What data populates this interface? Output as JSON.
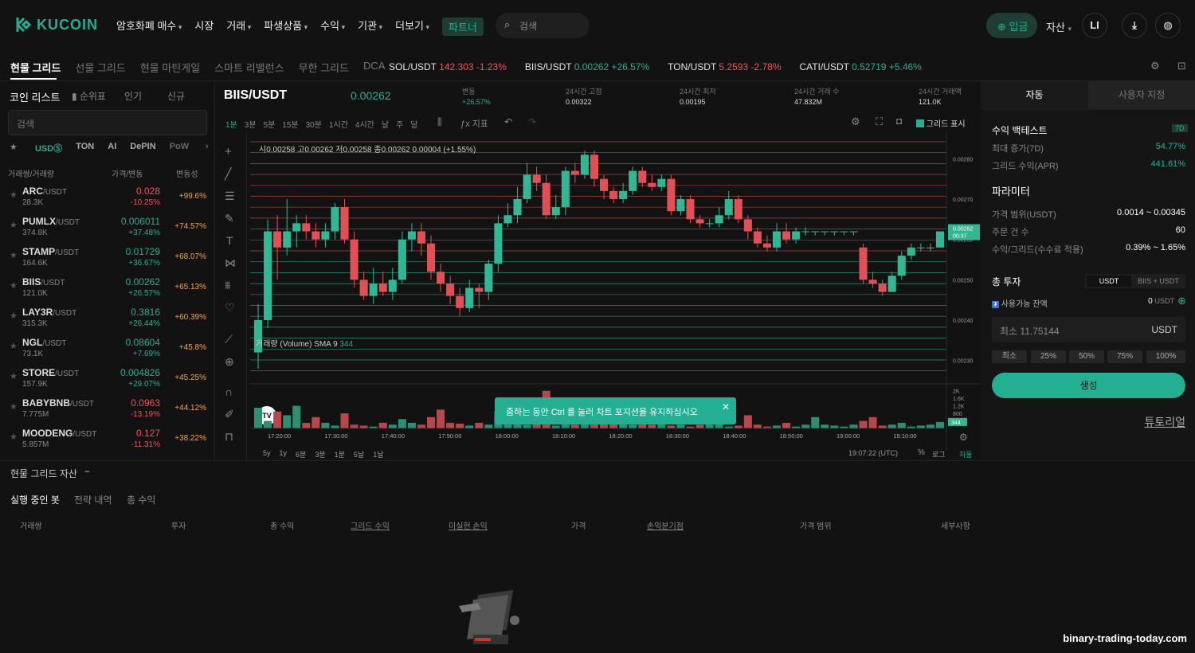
{
  "nav": {
    "logo": "KUCOIN",
    "items": [
      "암호화폐 매수",
      "시장",
      "거래",
      "파생상품",
      "수익",
      "기관",
      "더보기"
    ],
    "partner": "파트너",
    "search_placeholder": "검색",
    "deposit": "입금",
    "assets": "자산",
    "avatar": "LI"
  },
  "subtabs": [
    "현물 그리드",
    "선물 그리드",
    "현물 마틴게일",
    "스마트 리밸런스",
    "무한 그리드",
    "DCA"
  ],
  "tickers": [
    {
      "pair": "SOL/USDT",
      "price": "142.303",
      "change": "-1.23%",
      "dir": "down"
    },
    {
      "pair": "BIIS/USDT",
      "price": "0.00262",
      "change": "+26.57%",
      "dir": "up"
    },
    {
      "pair": "TON/USDT",
      "price": "5.2593",
      "change": "-2.78%",
      "dir": "down"
    },
    {
      "pair": "CATI/USDT",
      "price": "0.52719",
      "change": "+5.46%",
      "dir": "up"
    }
  ],
  "coinlist": {
    "title": "코인 리스트",
    "tabs": [
      "순위표",
      "인기",
      "신규"
    ],
    "search": "검색",
    "filters": [
      "USDⓈ",
      "TON",
      "AI",
      "DePIN",
      "PoW"
    ],
    "headers": [
      "거래쌍/거래량",
      "가격/변동",
      "변동성"
    ],
    "rows": [
      {
        "base": "ARC",
        "quote": "/USDT",
        "vol": "28.3K",
        "price": "0.028",
        "change": "-10.25%",
        "dir": "down",
        "volatility": "+99.6%"
      },
      {
        "base": "PUMLX",
        "quote": "/USDT",
        "vol": "374.8K",
        "price": "0.006011",
        "change": "+37.48%",
        "dir": "up",
        "volatility": "+74.57%"
      },
      {
        "base": "STAMP",
        "quote": "/USDT",
        "vol": "164.6K",
        "price": "0.01729",
        "change": "+36.67%",
        "dir": "up",
        "volatility": "+68.07%"
      },
      {
        "base": "BIIS",
        "quote": "/USDT",
        "vol": "121.0K",
        "price": "0.00262",
        "change": "+26.57%",
        "dir": "up",
        "volatility": "+65.13%"
      },
      {
        "base": "LAY3R",
        "quote": "/USDT",
        "vol": "315.3K",
        "price": "0.3816",
        "change": "+26.44%",
        "dir": "up",
        "volatility": "+60.39%"
      },
      {
        "base": "NGL",
        "quote": "/USDT",
        "vol": "73.1K",
        "price": "0.08604",
        "change": "+7.69%",
        "dir": "up",
        "volatility": "+45.8%"
      },
      {
        "base": "STORE",
        "quote": "/USDT",
        "vol": "157.9K",
        "price": "0.004826",
        "change": "+29.07%",
        "dir": "up",
        "volatility": "+45.25%"
      },
      {
        "base": "BABYBNB",
        "quote": "/USDT",
        "vol": "7.775M",
        "price": "0.0963",
        "change": "-13.19%",
        "dir": "down",
        "volatility": "+44.12%"
      },
      {
        "base": "MOODENG",
        "quote": "/USDT",
        "vol": "5.857M",
        "price": "0.127",
        "change": "-11.31%",
        "dir": "down",
        "volatility": "+38.22%"
      }
    ]
  },
  "pairheader": {
    "pair": "BIIS/USDT",
    "price": "0.00262",
    "stats": [
      {
        "label": "변동",
        "value": "+26.57%"
      },
      {
        "label": "24시간 고점",
        "value": "0.00322"
      },
      {
        "label": "24시간 최저",
        "value": "0.00195"
      },
      {
        "label": "24시간 거래 수",
        "value": "47.832M"
      },
      {
        "label": "24시간 거래액",
        "value": "121.0K"
      }
    ]
  },
  "toolbar": {
    "intervals": [
      "1분",
      "3분",
      "5분",
      "15분",
      "30분",
      "1시간",
      "4시간",
      "날",
      "주",
      "달"
    ],
    "indicator": "지표",
    "gridshow": "그리드 표시"
  },
  "chart": {
    "ohlc": "시0.00258 고0.00262 저0.00258 종0.00262 0.00004 (+1.55%)",
    "price_axis": [
      "0.00280",
      "0.00270",
      "0.00260",
      "0.00250",
      "0.00240",
      "0.00230"
    ],
    "current_tag": "0.00262",
    "countdown": "00:37",
    "volume_label": "거래량 (Volume) SMA 9",
    "volume_value": "344",
    "vol_axis": [
      "2K",
      "1.6K",
      "1.2K",
      "800",
      "400"
    ],
    "vol_tag": "344",
    "times": [
      "17:20:00",
      "17:30:00",
      "17:40:00",
      "17:50:00",
      "18:00:00",
      "18:10:00",
      "18:20:00",
      "18:30:00",
      "18:40:00",
      "18:50:00",
      "19:00:00",
      "19:10:00"
    ],
    "ranges": [
      "5y",
      "1y",
      "6분",
      "3분",
      "1분",
      "5날",
      "1날"
    ],
    "clock": "19:07:22 (UTC)",
    "pct": "%",
    "log": "로그",
    "auto": "자동",
    "toast": "줌하는 동안 Ctrl 를 눌러 차트 포지션을 유지하십시오"
  },
  "chart_data": {
    "type": "candlestick",
    "ylim": [
      0.00225,
      0.00285
    ],
    "candles": [
      [
        0.00232,
        0.0024,
        0.00244,
        0.00228
      ],
      [
        0.0024,
        0.00262,
        0.00265,
        0.00238
      ],
      [
        0.00262,
        0.00258,
        0.00266,
        0.0025
      ],
      [
        0.00258,
        0.00262,
        0.0027,
        0.00256
      ],
      [
        0.00262,
        0.00264,
        0.00266,
        0.00258
      ],
      [
        0.00264,
        0.00262,
        0.00266,
        0.0026
      ],
      [
        0.00262,
        0.0026,
        0.00264,
        0.00258
      ],
      [
        0.0026,
        0.00262,
        0.00264,
        0.00258
      ],
      [
        0.00262,
        0.00268,
        0.00269,
        0.0026
      ],
      [
        0.00268,
        0.0026,
        0.0027,
        0.00259
      ],
      [
        0.0026,
        0.0025,
        0.00262,
        0.00248
      ],
      [
        0.0025,
        0.00246,
        0.00252,
        0.00245
      ],
      [
        0.00246,
        0.00249,
        0.00253,
        0.00244
      ],
      [
        0.00249,
        0.00247,
        0.00252,
        0.00246
      ],
      [
        0.00247,
        0.0025,
        0.00253,
        0.00245
      ],
      [
        0.0025,
        0.0026,
        0.00262,
        0.00249
      ],
      [
        0.0026,
        0.00262,
        0.00264,
        0.00257
      ],
      [
        0.00262,
        0.00259,
        0.00264,
        0.00256
      ],
      [
        0.00259,
        0.00252,
        0.00261,
        0.0025
      ],
      [
        0.00252,
        0.00249,
        0.00254,
        0.00247
      ],
      [
        0.00249,
        0.00246,
        0.00251,
        0.00244
      ],
      [
        0.00246,
        0.00243,
        0.00248,
        0.00241
      ],
      [
        0.00243,
        0.00248,
        0.0025,
        0.00242
      ],
      [
        0.00248,
        0.00247,
        0.00249,
        0.00243
      ],
      [
        0.00247,
        0.00254,
        0.00255,
        0.00245
      ],
      [
        0.00254,
        0.00264,
        0.00266,
        0.00252
      ],
      [
        0.00264,
        0.00266,
        0.00269,
        0.00263
      ],
      [
        0.00266,
        0.0027,
        0.00273,
        0.00264
      ],
      [
        0.0027,
        0.00276,
        0.00279,
        0.00269
      ],
      [
        0.00276,
        0.00274,
        0.00278,
        0.00272
      ],
      [
        0.00274,
        0.00266,
        0.00276,
        0.00265
      ],
      [
        0.00266,
        0.00268,
        0.00271,
        0.00265
      ],
      [
        0.00268,
        0.00277,
        0.00278,
        0.00266
      ],
      [
        0.00277,
        0.00276,
        0.00279,
        0.00274
      ],
      [
        0.00276,
        0.00281,
        0.00282,
        0.00275
      ],
      [
        0.00281,
        0.00275,
        0.00282,
        0.00273
      ],
      [
        0.00275,
        0.00272,
        0.00276,
        0.0027
      ],
      [
        0.00272,
        0.0027,
        0.00273,
        0.00269
      ],
      [
        0.0027,
        0.00272,
        0.00274,
        0.00269
      ],
      [
        0.00272,
        0.00277,
        0.00278,
        0.00271
      ],
      [
        0.00277,
        0.00274,
        0.00278,
        0.00273
      ],
      [
        0.00274,
        0.00273,
        0.00276,
        0.00272
      ],
      [
        0.00273,
        0.00275,
        0.00276,
        0.00272
      ],
      [
        0.00275,
        0.00267,
        0.00276,
        0.00266
      ],
      [
        0.00267,
        0.0027,
        0.00271,
        0.00266
      ],
      [
        0.0027,
        0.00265,
        0.00271,
        0.00264
      ],
      [
        0.00265,
        0.00264,
        0.00266,
        0.00263
      ],
      [
        0.00264,
        0.00264,
        0.00265,
        0.00263
      ],
      [
        0.00264,
        0.00266,
        0.00268,
        0.00263
      ],
      [
        0.00266,
        0.0027,
        0.00272,
        0.00265
      ],
      [
        0.0027,
        0.00265,
        0.00271,
        0.00264
      ],
      [
        0.00265,
        0.00262,
        0.00266,
        0.0026
      ],
      [
        0.00262,
        0.00259,
        0.00263,
        0.00258
      ],
      [
        0.00259,
        0.00258,
        0.00261,
        0.00257
      ],
      [
        0.00258,
        0.00262,
        0.00264,
        0.00257
      ],
      [
        0.00262,
        0.0026,
        0.00264,
        0.00259
      ],
      [
        0.0026,
        0.00262,
        0.00263,
        0.00259
      ],
      [
        0.00262,
        0.00262,
        0.00263,
        0.00261
      ],
      [
        0.00262,
        0.00262,
        0.00262,
        0.00261
      ],
      [
        0.00262,
        0.00262,
        0.00262,
        0.00261
      ],
      [
        0.00262,
        0.00262,
        0.00262,
        0.00261
      ],
      [
        0.00262,
        0.00262,
        0.00262,
        0.00261
      ],
      [
        0.00262,
        0.00262,
        0.00262,
        0.00261
      ],
      [
        0.00258,
        0.0025,
        0.00259,
        0.00249
      ],
      [
        0.0025,
        0.00249,
        0.00252,
        0.00248
      ],
      [
        0.00249,
        0.00247,
        0.0025,
        0.00246
      ],
      [
        0.00247,
        0.00251,
        0.00252,
        0.00247
      ],
      [
        0.00251,
        0.00256,
        0.00257,
        0.0025
      ],
      [
        0.00256,
        0.00258,
        0.00259,
        0.00255
      ],
      [
        0.00258,
        0.00258,
        0.00259,
        0.00257
      ],
      [
        0.00258,
        0.00258,
        0.00259,
        0.00257
      ],
      [
        0.00258,
        0.00262,
        0.00262,
        0.00258
      ]
    ],
    "volumes": [
      1100,
      400,
      900,
      700,
      1200,
      300,
      600,
      300,
      150,
      800,
      200,
      150,
      100,
      300,
      200,
      500,
      300,
      200,
      600,
      1000,
      300,
      250,
      150,
      300,
      200,
      900,
      300,
      400,
      200,
      800,
      2000,
      150,
      600,
      200,
      300,
      1000,
      500,
      400,
      300,
      200,
      900,
      200,
      300,
      150,
      200,
      100,
      200,
      300,
      400,
      100,
      150,
      700,
      200,
      100,
      150,
      300,
      100,
      200,
      600,
      200,
      150,
      100,
      200,
      400,
      600,
      150,
      200,
      300,
      100,
      150,
      200,
      344
    ]
  },
  "rightpanel": {
    "tabs": [
      "자동",
      "사용자 지정"
    ],
    "backtest": "수익 백테스트",
    "period": "7D",
    "max_inc_label": "최대 증가(7D)",
    "max_inc": "54.77%",
    "apr_label": "그리드 수익(APR)",
    "apr": "441.61%",
    "params": "파라미터",
    "range_label": "가격 범위(USDT)",
    "range": "0.0014 ~ 0.00345",
    "orders_label": "주문 건 수",
    "orders": "60",
    "profit_label": "수익/그리드(수수료 적용)",
    "profit": "0.39% ~ 1.65%",
    "invest": "총 투자",
    "ccy1": "USDT",
    "ccy2": "BIIS + USDT",
    "avail": "사용가능 잔액",
    "avail_val": "0",
    "avail_ccy": "USDT",
    "min_placeholder": "최소 11.75144",
    "input_ccy": "USDT",
    "pcts": [
      "최소",
      "25%",
      "50%",
      "75%",
      "100%"
    ],
    "create": "생성",
    "tutorial": "튜토리얼"
  },
  "bottom": {
    "title": "현물 그리드 자산",
    "tabs": [
      "실행 중인 봇",
      "전략 내역",
      "총 수익"
    ],
    "cols": [
      "거래쌍",
      "투자",
      "총 수익",
      "그리드 수익",
      "미실현 손익",
      "가격",
      "손익분기점",
      "가격 범위",
      "세부사항"
    ],
    "watermark": "binary-trading-today.com"
  }
}
